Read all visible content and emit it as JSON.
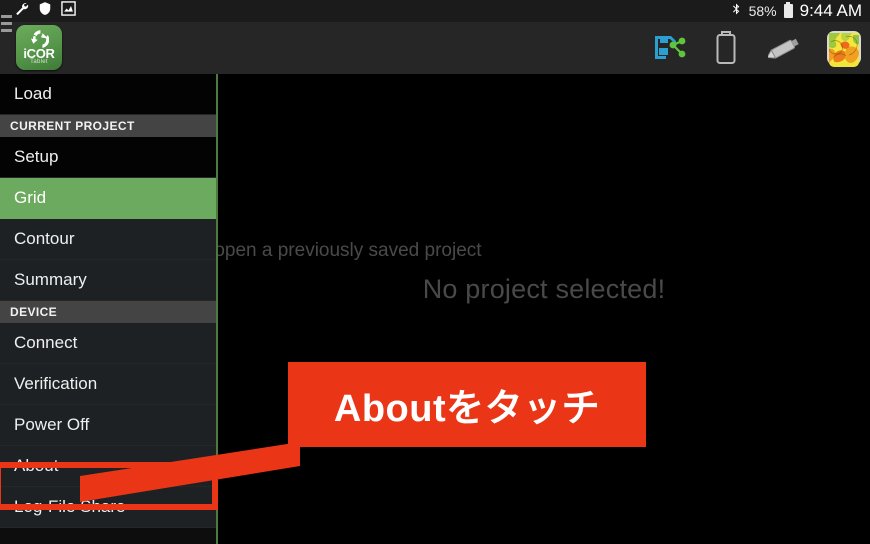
{
  "statusbar": {
    "left_icons": [
      "wrench-icon",
      "shield-icon",
      "chart-frame-icon"
    ],
    "bluetooth_icon": "bluetooth-icon",
    "battery_percent": "58%",
    "battery_icon": "battery-icon",
    "clock": "9:44 AM"
  },
  "actionbar": {
    "menu_icon": "hamburger-menu-icon",
    "logo": {
      "name": "iCOR",
      "subtitle": "Tablet"
    },
    "buttons": [
      {
        "name": "save-share-icon",
        "label": "Save / Share"
      },
      {
        "name": "battery-status-icon",
        "label": "Battery"
      },
      {
        "name": "probe-icon",
        "label": "Probe"
      },
      {
        "name": "contour-map-icon",
        "label": "Map"
      }
    ]
  },
  "sidebar": {
    "items": [
      {
        "label": "Load",
        "type": "item",
        "style": "dark",
        "selected": false
      },
      {
        "label": "CURRENT PROJECT",
        "type": "section"
      },
      {
        "label": "Setup",
        "type": "item",
        "style": "dark",
        "selected": false
      },
      {
        "label": "Grid",
        "type": "item",
        "style": "normal",
        "selected": true
      },
      {
        "label": "Contour",
        "type": "item",
        "style": "normal",
        "selected": false
      },
      {
        "label": "Summary",
        "type": "item",
        "style": "normal",
        "selected": false
      },
      {
        "label": "DEVICE",
        "type": "section"
      },
      {
        "label": "Connect",
        "type": "item",
        "style": "normal",
        "selected": false
      },
      {
        "label": "Verification",
        "type": "item",
        "style": "normal",
        "selected": false
      },
      {
        "label": "Power Off",
        "type": "item",
        "style": "normal",
        "selected": false
      },
      {
        "label": "About",
        "type": "item",
        "style": "normal",
        "selected": false
      },
      {
        "label": "Log-File Share",
        "type": "item",
        "style": "normal",
        "selected": false
      }
    ]
  },
  "content": {
    "empty_title": "No project selected!",
    "empty_subtitle": "Please create a new project or open a previously saved project"
  },
  "annotation": {
    "callout_text": "Aboutをタッチ",
    "highlight_target": "About",
    "color": "#ea3517"
  },
  "colors": {
    "accent_green": "#6cab5f",
    "divider_green": "#4d7a3f",
    "actionbar": "#262626",
    "sidebar_item": "#1d2124",
    "section_header": "#444444",
    "annotation_red": "#ea3517"
  }
}
